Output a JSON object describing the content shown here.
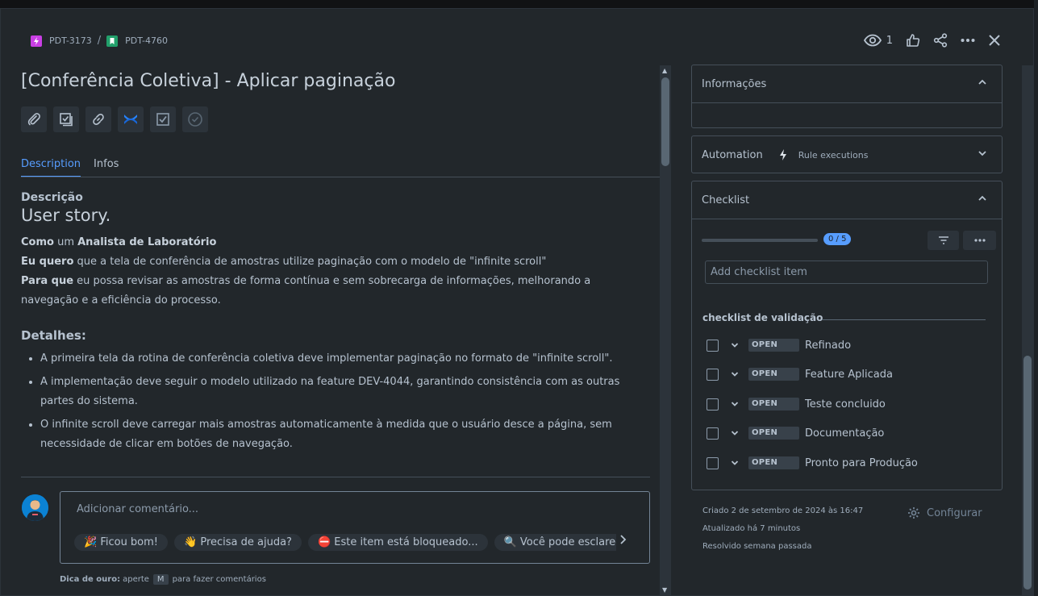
{
  "breadcrumb": {
    "parent_key": "PDT-3173",
    "separator": "/",
    "issue_key": "PDT-4760"
  },
  "header": {
    "watch_count": "1"
  },
  "issue": {
    "title": "[Conferência Coletiva] - Aplicar paginação"
  },
  "tabs": [
    {
      "label": "Description",
      "active": true
    },
    {
      "label": "Infos",
      "active": false
    }
  ],
  "description": {
    "heading": "Descrição",
    "story_heading": "User story.",
    "como_label": "Como",
    "como_mid": " um ",
    "como_role": "Analista de Laboratório",
    "quero_label": "Eu quero",
    "quero_text": " que a tela de conferência de amostras utilize paginação com o modelo de \"infinite scroll\"",
    "para_label": "Para que",
    "para_text": " eu possa revisar as amostras de forma contínua e sem sobrecarga de informações, melhorando a navegação e a eficiência do processo.",
    "details_heading": "Detalhes:",
    "bullets": [
      "A primeira tela da rotina de conferência coletiva deve implementar paginação no formato de \"infinite scroll\".",
      "A implementação deve seguir o modelo utilizado na feature DEV-4044, garantindo consistência com as outras partes do sistema.",
      "O infinite scroll deve carregar mais amostras automaticamente à medida que o usuário desce a página, sem necessidade de clicar em botões de navegação."
    ]
  },
  "comment": {
    "placeholder": "Adicionar comentário...",
    "chips": [
      "🎉 Ficou bom!",
      "👋 Precisa de ajuda?",
      "⛔ Este item está bloqueado...",
      "🔍 Você pode esclarecer..."
    ],
    "tip_bold": "Dica de ouro:",
    "tip_pre": "aperte",
    "tip_key": "M",
    "tip_post": "para fazer comentários"
  },
  "panels": {
    "informacoes": {
      "title": "Informações"
    },
    "automation": {
      "title": "Automation",
      "sub": "Rule executions"
    },
    "checklist": {
      "title": "Checklist",
      "progress_text": "0 / 5",
      "progress_fraction": 0,
      "add_placeholder": "Add checklist item",
      "group_title": "checklist de validação",
      "items": [
        {
          "status": "OPEN",
          "label": "Refinado"
        },
        {
          "status": "OPEN",
          "label": "Feature Aplicada"
        },
        {
          "status": "OPEN",
          "label": "Teste concluido"
        },
        {
          "status": "OPEN",
          "label": "Documentação"
        },
        {
          "status": "OPEN",
          "label": "Pronto para Produção"
        }
      ]
    }
  },
  "meta": {
    "created": "Criado 2 de setembro de 2024 às 16:47",
    "updated": "Atualizado há 7 minutos",
    "resolved": "Resolvido semana passada",
    "configure": "Configurar"
  },
  "colors": {
    "accent": "#579dff",
    "background": "#22272b",
    "epic": "#c93fe4",
    "story": "#22a06b"
  }
}
